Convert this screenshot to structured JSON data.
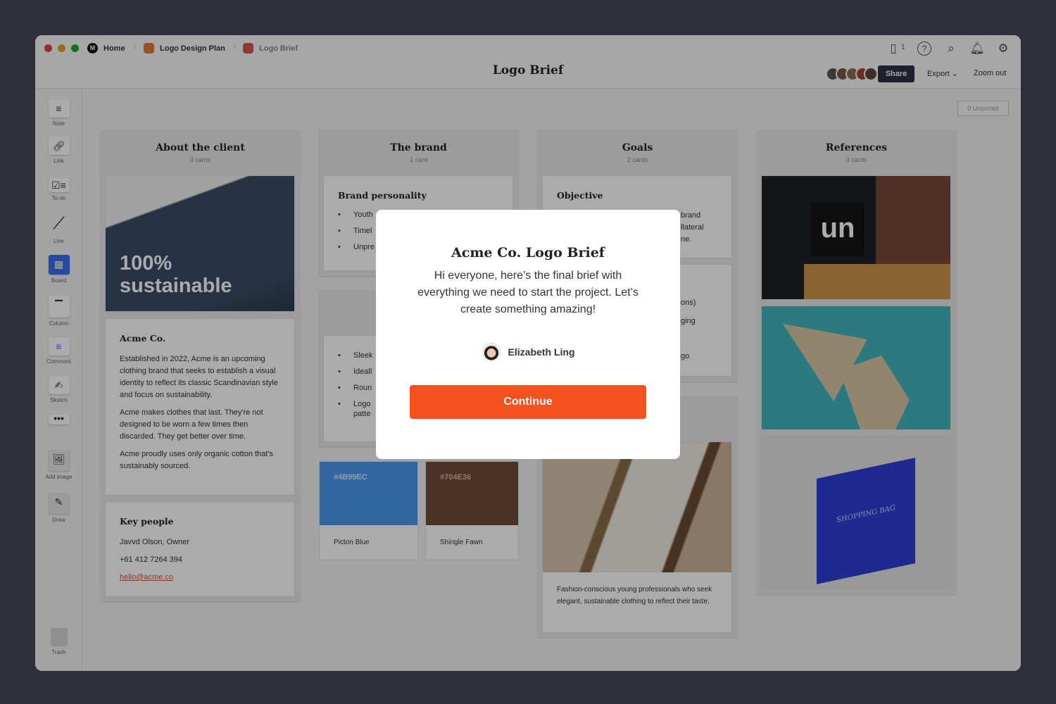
{
  "breadcrumb": [
    {
      "label": "Home"
    },
    {
      "label": "Logo Design Plan",
      "color": "#e07b39"
    },
    {
      "label": "Logo Brief",
      "color": "#d9534f"
    }
  ],
  "header": {
    "title": "Logo Brief",
    "device_count": "1",
    "share": "Share",
    "export": "Export",
    "zoom_out": "Zoom out"
  },
  "unsorted": "0 Unsorted",
  "sidebar": [
    {
      "label": "Note",
      "icon": "note-icon"
    },
    {
      "label": "Link",
      "icon": "link-icon"
    },
    {
      "label": "To-do",
      "icon": "todo-icon"
    },
    {
      "label": "Line",
      "icon": "line-icon"
    },
    {
      "label": "Board",
      "icon": "board-icon"
    },
    {
      "label": "Column",
      "icon": "column-icon"
    },
    {
      "label": "Comment",
      "icon": "comment-icon"
    },
    {
      "label": "Sketch",
      "icon": "sketch-icon"
    },
    {
      "label": "Add image",
      "icon": "image-icon"
    },
    {
      "label": "Draw",
      "icon": "pen-icon"
    },
    {
      "label": "Trash",
      "icon": "trash-icon"
    }
  ],
  "columns": {
    "about": {
      "title": "About the client",
      "count": "3 cards",
      "image_text": "100% sustainable",
      "acme_title": "Acme Co.",
      "acme_p1": "Established in 2022, Acme is an upcoming clothing brand that seeks to establish a visual identity to reflect its classic Scandinavian style and focus on sustainability.",
      "acme_p2": "Acme makes clothes that last. They're not designed to be worn a few times then discarded. They get better over time.",
      "acme_p3": "Acme proudly uses only organic cotton that's sustainably sourced.",
      "people_title": "Key people",
      "people": [
        "Javvd Olson, Owner",
        "+61 412 7264 394"
      ],
      "email": "hello@acme.co"
    },
    "brand": {
      "title": "The brand",
      "count": "1 card",
      "personality_title": "Brand personality",
      "personality": [
        "Youth",
        "Timel",
        "Unpre"
      ],
      "bullets2": [
        "Sleek",
        "Ideall",
        "Roun",
        "Logo"
      ],
      "bullets2_extra": "patte",
      "swatches": [
        {
          "hex": "#4B99EC",
          "name": "Picton Blue"
        },
        {
          "hex": "#704E36",
          "name": "Shingle Fawn"
        }
      ]
    },
    "goals": {
      "title": "Goals",
      "count": "2 cards",
      "objective_title": "Objective",
      "objective_frag": [
        "brand",
        "llateral",
        "ne."
      ],
      "frag2": [
        "ons)",
        "ging",
        "go"
      ],
      "audience": "Fashion-conscious young professionals who seek elegant, sustainable clothing to reflect their taste."
    },
    "references": {
      "title": "References",
      "count": "3 cards",
      "sign_text": "un",
      "bag_text": "SHOPPING BAG"
    }
  },
  "modal": {
    "title": "Acme Co. Logo Brief",
    "message": "Hi everyone, here’s the final brief with everything we need to start the project. Let’s create something amazing!",
    "author": "Elizabeth Ling",
    "button": "Continue",
    "button_color": "#F4511E"
  }
}
